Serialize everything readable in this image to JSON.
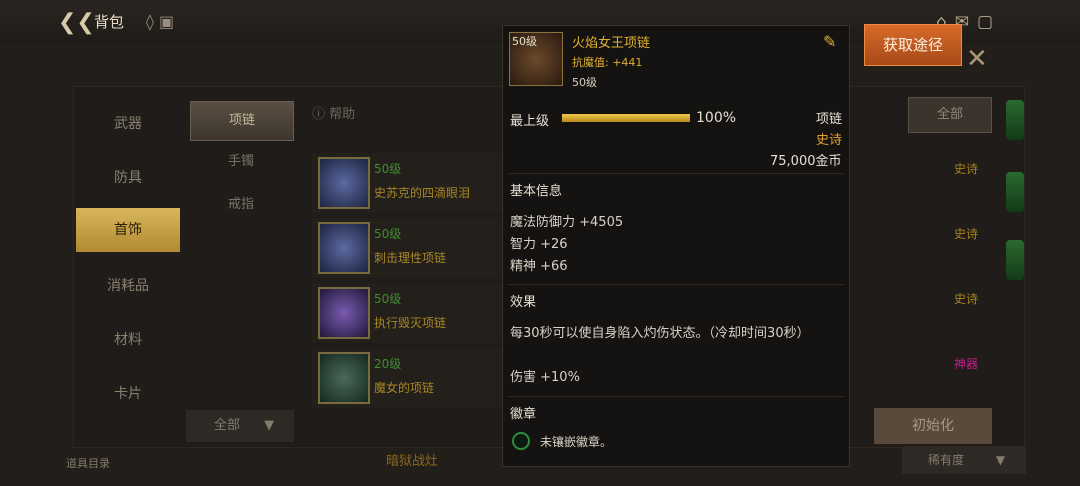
{
  "header": {
    "back_icon": "back-arrow-icon",
    "title": "背包"
  },
  "left_tabs": [
    "武器",
    "防具",
    "首饰",
    "消耗品",
    "材料",
    "卡片"
  ],
  "active_left_tab": "首饰",
  "sub_tabs": [
    "项链",
    "手镯",
    "戒指"
  ],
  "help_label": "帮助",
  "filter_all": "全部",
  "list_rows": [
    {
      "level": "50级",
      "name": "史苏克的四滴眼泪",
      "tag": "史诗"
    },
    {
      "level": "50级",
      "name": "刺击理性项链",
      "tag": "史诗"
    },
    {
      "level": "50级",
      "name": "执行毁灭项链",
      "tag": "史诗"
    },
    {
      "level": "20级",
      "name": "魔女的项链",
      "tag": "神器"
    }
  ],
  "bottom": {
    "dropdown_all": "全部",
    "init_button": "初始化",
    "left_label": "道具目录",
    "mid_label": "暗狱战灶",
    "sort_label": "稀有度"
  },
  "acquire_button": "获取途径",
  "tooltip": {
    "icon_level": "50级",
    "name": "火焰女王项链",
    "stat_line": "抗魔值: +441",
    "level": "50级",
    "upgrade_label": "最上级",
    "upgrade_progress": 1.0,
    "upgrade_pct": "100%",
    "type": "项链",
    "rarity": "史诗",
    "price": "75,000金币",
    "basic_info_title": "基本信息",
    "basic_stats": [
      "魔法防御力 +4505",
      "智力 +26",
      "精神 +66"
    ],
    "effect_title": "效果",
    "effect_text": "每30秒可以使自身陷入灼伤状态。（冷却时间30秒）",
    "effect_bonus": "伤害 +10%",
    "emblem_title": "徽章",
    "emblem_text": "未镶嵌徽章。"
  },
  "colors": {
    "accent_gold": "#e0b030",
    "epic_orange": "#e0a030",
    "acquire_orange": "#d86a2a"
  }
}
